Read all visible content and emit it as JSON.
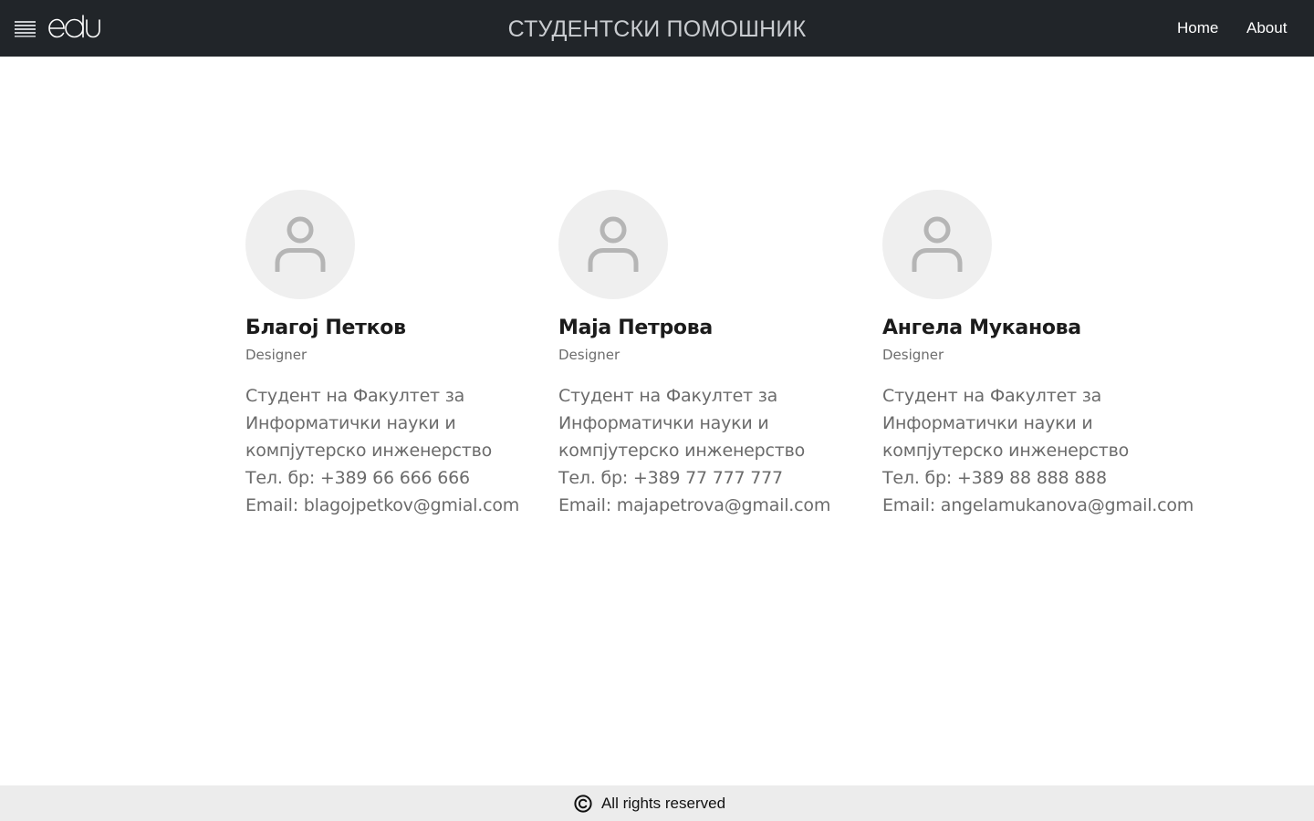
{
  "header": {
    "title": "СТУДЕНТСКИ ПОМОШНИК",
    "logo_text": "edu",
    "nav": {
      "home": "Home",
      "about": "About"
    }
  },
  "team": [
    {
      "name": "Благој Петков",
      "role": "Designer",
      "bio_lines": [
        "Студент на Факултет за",
        "Информатички науки и",
        "компјутерско инженерство"
      ],
      "phone": "Тел. бр: +389 66 666 666",
      "email": "Email: blagojpetkov@gmial.com"
    },
    {
      "name": "Маја Петрова",
      "role": "Designer",
      "bio_lines": [
        "Студент на Факултет за",
        "Информатички науки и",
        "компјутерско инженерство"
      ],
      "phone": "Тел. бр: +389 77 777 777",
      "email": "Email: majapetrova@gmail.com"
    },
    {
      "name": "Ангела Муканова",
      "role": "Designer",
      "bio_lines": [
        "Студент на Факултет за",
        "Информатички науки и",
        "компјутерско инженерство"
      ],
      "phone": "Тел. бр: +389 88 888 888",
      "email": "Email: angelamukanova@gmail.com"
    }
  ],
  "footer": {
    "text": "All rights reserved",
    "icon": "copyright-icon"
  },
  "colors": {
    "navbar": "#212529",
    "avatar_bg": "#efefef",
    "avatar_icon": "#b5b5b5",
    "footer_bg": "#ececec"
  }
}
